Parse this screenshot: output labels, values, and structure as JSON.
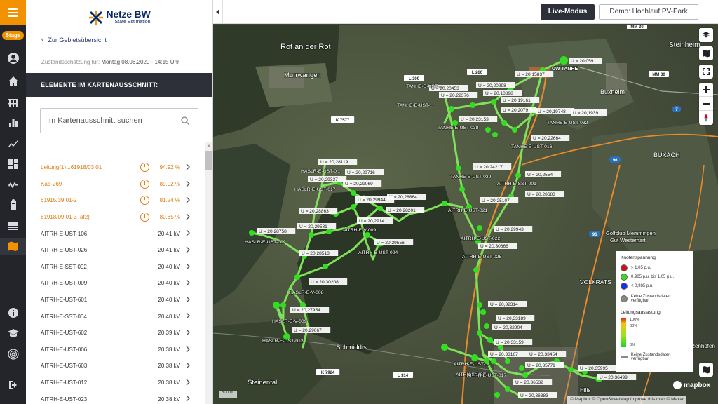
{
  "brand": {
    "name": "Netze BW",
    "subtitle": "State Estimation"
  },
  "rail": {
    "stage_badge": "Stage"
  },
  "sidebar": {
    "back_label": "Zur Gebietsübersicht",
    "estimate_label": "Zustandsschätzung für:",
    "estimate_value": "Montag 08.06.2020 - 14:15 Uhr",
    "section_title": "ELEMENTE IM KARTENAUSSCHNITT:",
    "search_placeholder": "Im Kartenausschnitt suchen",
    "items": [
      {
        "name": "Leitung(1)...61918/03 01",
        "value": "94.92 %",
        "alert": true
      },
      {
        "name": "Kab-269",
        "value": "89.02 %",
        "alert": true
      },
      {
        "name": "61915/39 01-2",
        "value": "81.24 %",
        "alert": true
      },
      {
        "name": "61918/09 01-3_af2)",
        "value": "80.65 %",
        "alert": true
      },
      {
        "name": "AITRH-E-UST-106",
        "value": "20.41 kV",
        "alert": false
      },
      {
        "name": "AITRH-E-UST-026",
        "value": "20.41 kV",
        "alert": false
      },
      {
        "name": "AITRH-E-SST-002",
        "value": "20.40 kV",
        "alert": false
      },
      {
        "name": "AITRH-E-UST-009",
        "value": "20.40 kV",
        "alert": false
      },
      {
        "name": "AITRH-E-UST-601",
        "value": "20.40 kV",
        "alert": false
      },
      {
        "name": "AITRH-E-SST-004",
        "value": "20.40 kV",
        "alert": false
      },
      {
        "name": "AITRH-E-UST-602",
        "value": "20.39 kV",
        "alert": false
      },
      {
        "name": "AITRH-E-UST-006",
        "value": "20.38 kV",
        "alert": false
      },
      {
        "name": "AITRH-E-UST-603",
        "value": "20.38 kV",
        "alert": false
      },
      {
        "name": "AITRH-E-UST-012",
        "value": "20.38 kV",
        "alert": false
      },
      {
        "name": "AITRH-E-UST-023",
        "value": "20.38 kV",
        "alert": false
      }
    ]
  },
  "topbar": {
    "live_label": "Live-Modus",
    "demo_label": "Demo: Hochlauf PV-Park"
  },
  "map": {
    "places": [
      "Rot an der Rot",
      "Murrwangen",
      "Steinheim",
      "Buxheim",
      "BUXACH",
      "Golfclub Memmingen",
      "Gut Westerhart",
      "VOLKRATS",
      "Schmiddis",
      "Steinental",
      "Hilfs",
      "zenhofen",
      "UW TANHE"
    ],
    "roads": [
      "L 300",
      "MM 30",
      "L 260",
      "L 300",
      "K 7577",
      "96",
      "96",
      "7",
      "MM 30",
      "K 7924",
      "L 314"
    ],
    "values": [
      "U = 20,059",
      "U = 20,15837",
      "U = 20,20453",
      "U = 20,20298",
      "U = 20,22376",
      "U = 20,18898",
      "U = 20,19161",
      "U = 20,2079",
      "U = 20,19748",
      "U = 20,1939",
      "U = 20,23153",
      "U = 20,22664",
      "U = 20,28119",
      "U = 20,29716",
      "U = 20,29337",
      "U = 20,29069",
      "U = 20,24217",
      "U = 20,2554",
      "U = 20,28683",
      "U = 20,28864",
      "U = 20,29944",
      "U = 20,28201",
      "U = 20,25107",
      "U = 20,28863",
      "U = 20,29581",
      "U = 20,2914",
      "U = 20,28758",
      "U = 20,29943",
      "U = 20,29556",
      "U = 20,30666",
      "U = 20,28518",
      "U = 20,30208",
      "U = 20,27954",
      "U = 20,32314",
      "U = 20,29067",
      "U = 20,33189",
      "U = 20,32904",
      "U = 20,33159",
      "U = 20,33167",
      "U = 20,33454",
      "U = 20,35771",
      "U = 20,35995",
      "U = 20,36532",
      "U = 20,36499",
      "U = 20,36383"
    ],
    "stations": [
      "TANHE-E-UST-...",
      "TANHE-E-UST-...",
      "TANHE-E-UST-038",
      "TANHE-E-UST-032",
      "TANHE-E-UST-016",
      "TANHE-E-UST-039",
      "AITRH-E-SST-001",
      "HASLR-E-UST-0...",
      "HASLR-E-UST-017",
      "AITRH-E-UST-021",
      "AITRH-E-V-009",
      "HASLR-E-UST-009",
      "AITRH-E-UST-024",
      "AITRH-E-UST-022",
      "AITRH-E-UST-025",
      "HASLR-E-V-008",
      "HASLR-E-V-009",
      "HASLR-E-UST-012",
      "AITRH-E-UST-...",
      "AITRH-E-UST...",
      "AITRH-E-UST-017"
    ],
    "scale": "500 m",
    "mapbox_label": "mapbox",
    "attribution": "© Mapbox © OpenStreetMap  Improve this map  © Maxar"
  },
  "legend": {
    "voltage_title": "Knotenspannung",
    "voltage_items": [
      {
        "label": "> 1,05 p.u.",
        "color": "#cc1111"
      },
      {
        "label": "0,985 p.u. bis 1,05 p.u.",
        "color": "#33dd22"
      },
      {
        "label": "< 0,985 p.u.",
        "color": "#1133ee"
      },
      {
        "label": "Keine Zustandsdaten verfügbar",
        "color": "#888888"
      }
    ],
    "load_title": "Leitungsauslastung",
    "load_ticks": [
      "100%",
      "80%",
      "0%"
    ],
    "load_none": "Keine Zustandsdaten verfügbar"
  },
  "colors": {
    "accent": "#f39200",
    "rail": "#23252b",
    "network": "#33dd22",
    "line": "#7fe15a"
  }
}
